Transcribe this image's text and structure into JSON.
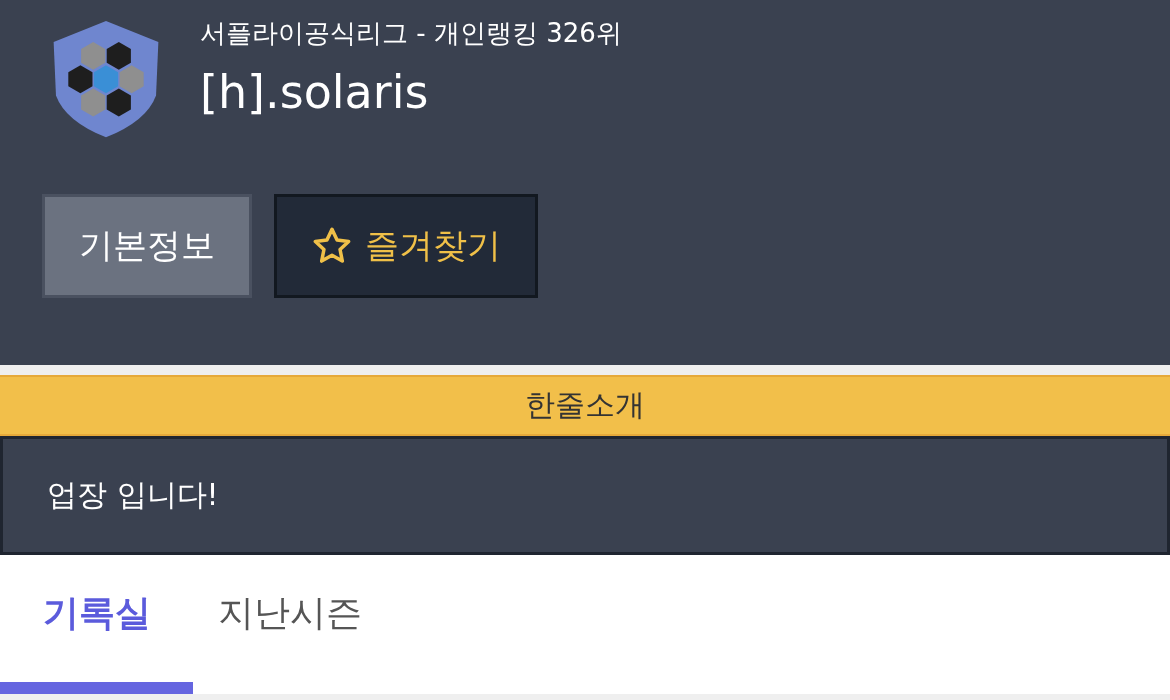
{
  "profile": {
    "subtitle": "서플라이공식리그 - 개인랭킹 326위",
    "name": "[h].solaris"
  },
  "buttons": [
    {
      "label": "기본정보",
      "kind": "plain"
    },
    {
      "label": "즐겨찾기",
      "kind": "favorite"
    }
  ],
  "intro": {
    "heading": "한줄소개",
    "text": "업장 입니다!"
  },
  "tabs": [
    {
      "label": "기록실",
      "selected": true
    },
    {
      "label": "지난시즌",
      "selected": false
    }
  ]
}
